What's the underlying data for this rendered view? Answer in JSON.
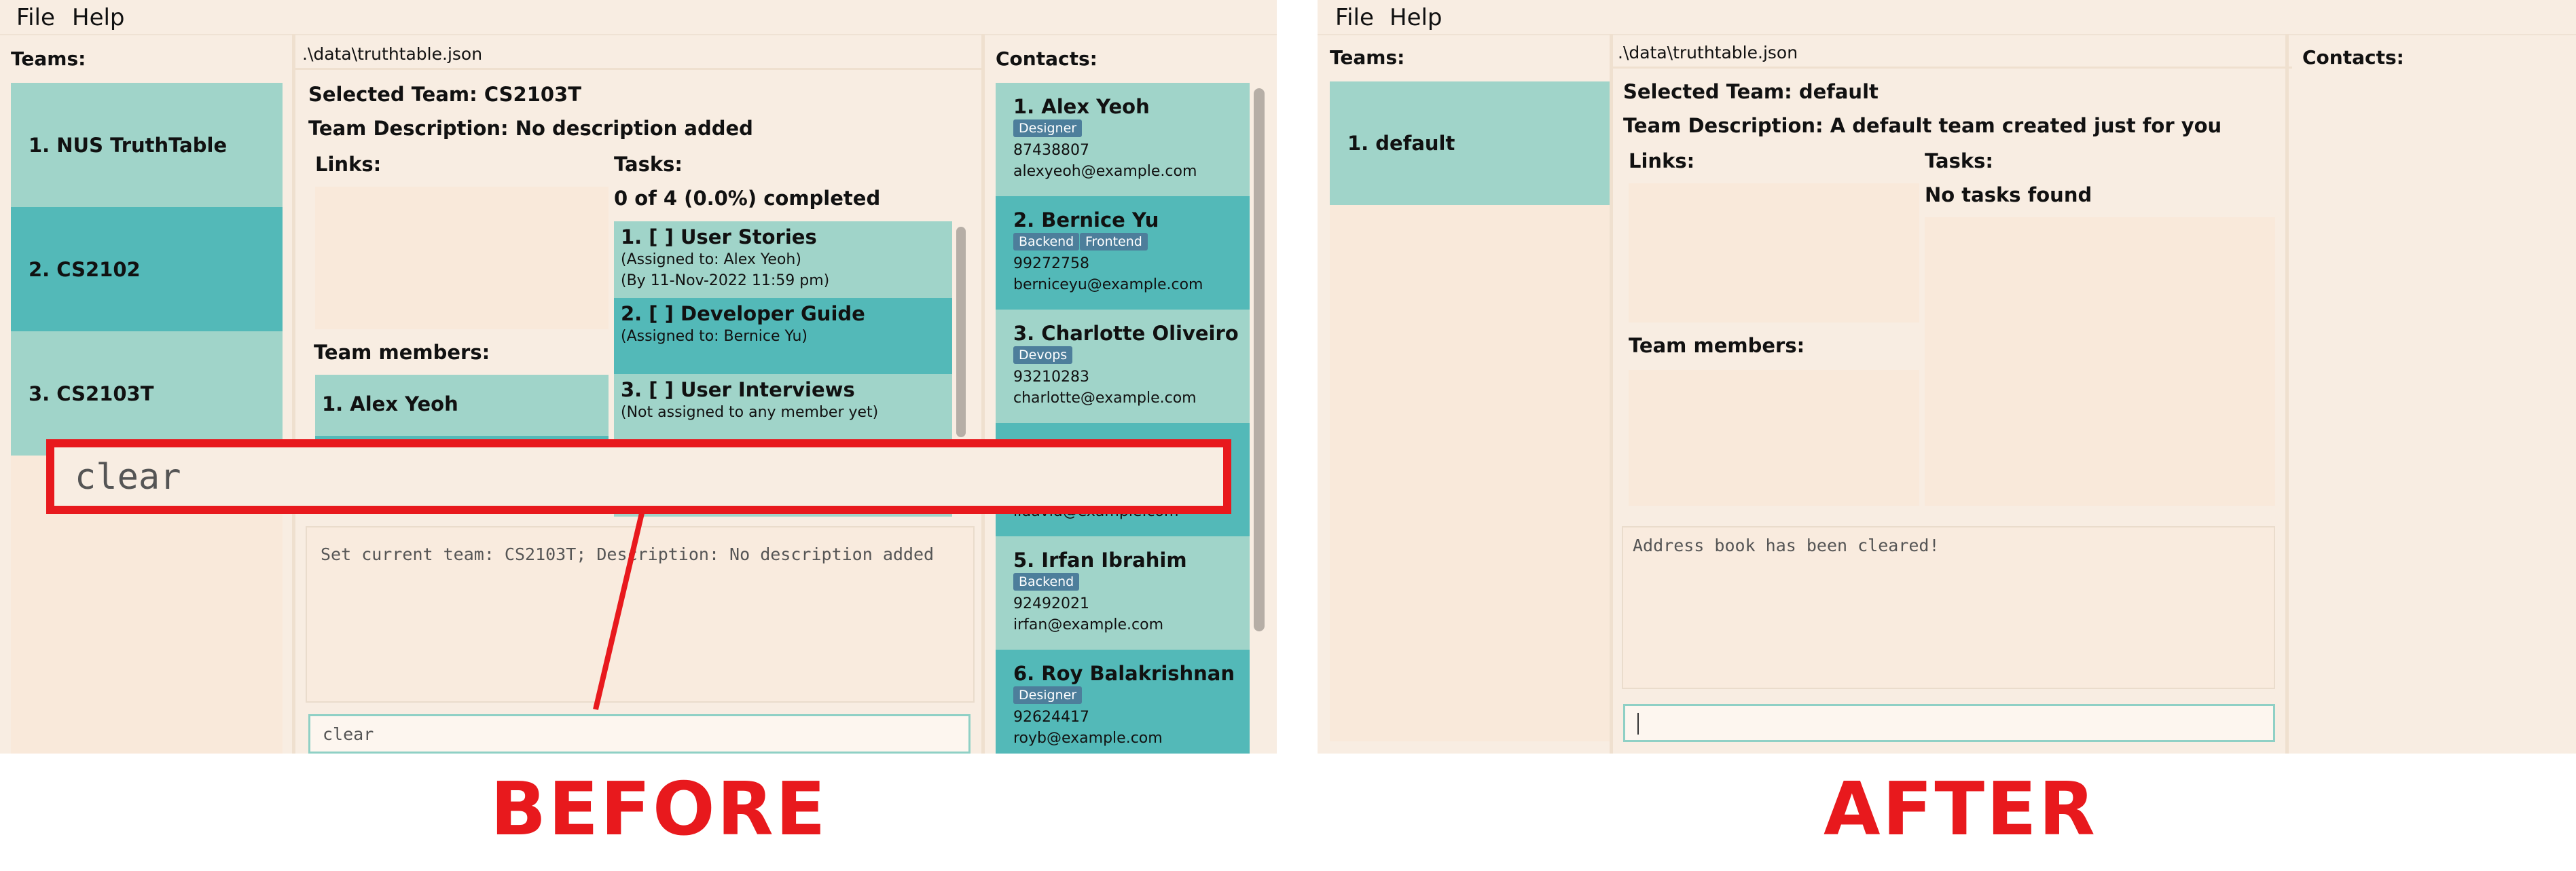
{
  "before": {
    "menu": [
      "File",
      "Help"
    ],
    "teams_title": "Teams:",
    "teams": [
      "1. NUS TruthTable",
      "2. CS2102",
      "3. CS2103T"
    ],
    "file_path": ".\\data\\truthtable.json",
    "selected_team": "Selected Team: CS2103T",
    "team_description": "Team Description: No description added",
    "links_title": "Links:",
    "tasks_title": "Tasks:",
    "tasks_summary": "0 of 4 (0.0%) completed",
    "tasks": [
      {
        "title": "1. [ ] User Stories",
        "assigned": "(Assigned to: Alex Yeoh)",
        "due": "(By 11-Nov-2022 11:59 pm)"
      },
      {
        "title": "2. [ ] Developer Guide",
        "assigned": "(Assigned to: Bernice Yu)",
        "due": ""
      },
      {
        "title": "3. [ ] User Interviews",
        "assigned": "(Not assigned to any member yet)",
        "due": ""
      }
    ],
    "members_title": "Team members:",
    "members": [
      "1. Alex Yeoh"
    ],
    "result_text": "Set current team: CS2103T; Description: No description added",
    "command_value": "clear",
    "overlay_command": "clear",
    "contacts_title": "Contacts:",
    "contacts": [
      {
        "name": "1. Alex Yeoh",
        "tags": [
          "Designer"
        ],
        "phone": "87438807",
        "email": "alexyeoh@example.com"
      },
      {
        "name": "2. Bernice Yu",
        "tags": [
          "Backend",
          "Frontend"
        ],
        "phone": "99272758",
        "email": "berniceyu@example.com"
      },
      {
        "name": "3. Charlotte Oliveiro",
        "tags": [
          "Devops"
        ],
        "phone": "93210283",
        "email": "charlotte@example.com"
      },
      {
        "name": "",
        "tags": [],
        "phone": "",
        "email": "lidavid@example.com"
      },
      {
        "name": "5. Irfan Ibrahim",
        "tags": [
          "Backend"
        ],
        "phone": "92492021",
        "email": "irfan@example.com"
      },
      {
        "name": "6. Roy Balakrishnan",
        "tags": [
          "Designer"
        ],
        "phone": "92624417",
        "email": "royb@example.com"
      }
    ],
    "label": "BEFORE"
  },
  "after": {
    "menu": [
      "File",
      "Help"
    ],
    "teams_title": "Teams:",
    "teams": [
      "1. default"
    ],
    "file_path": ".\\data\\truthtable.json",
    "selected_team": "Selected Team: default",
    "team_description": "Team Description: A default team created just for you",
    "links_title": "Links:",
    "tasks_title": "Tasks:",
    "tasks_summary": "No tasks found",
    "members_title": "Team members:",
    "result_text": "Address book has been cleared!",
    "command_value": "",
    "contacts_title": "Contacts:",
    "label": "AFTER"
  },
  "colors": {
    "accent_red": "#e8191d",
    "teal_light": "#a0d4c9",
    "teal_dark": "#53b9b8",
    "background": "#f8ede2",
    "tag": "#4d7e9b"
  }
}
